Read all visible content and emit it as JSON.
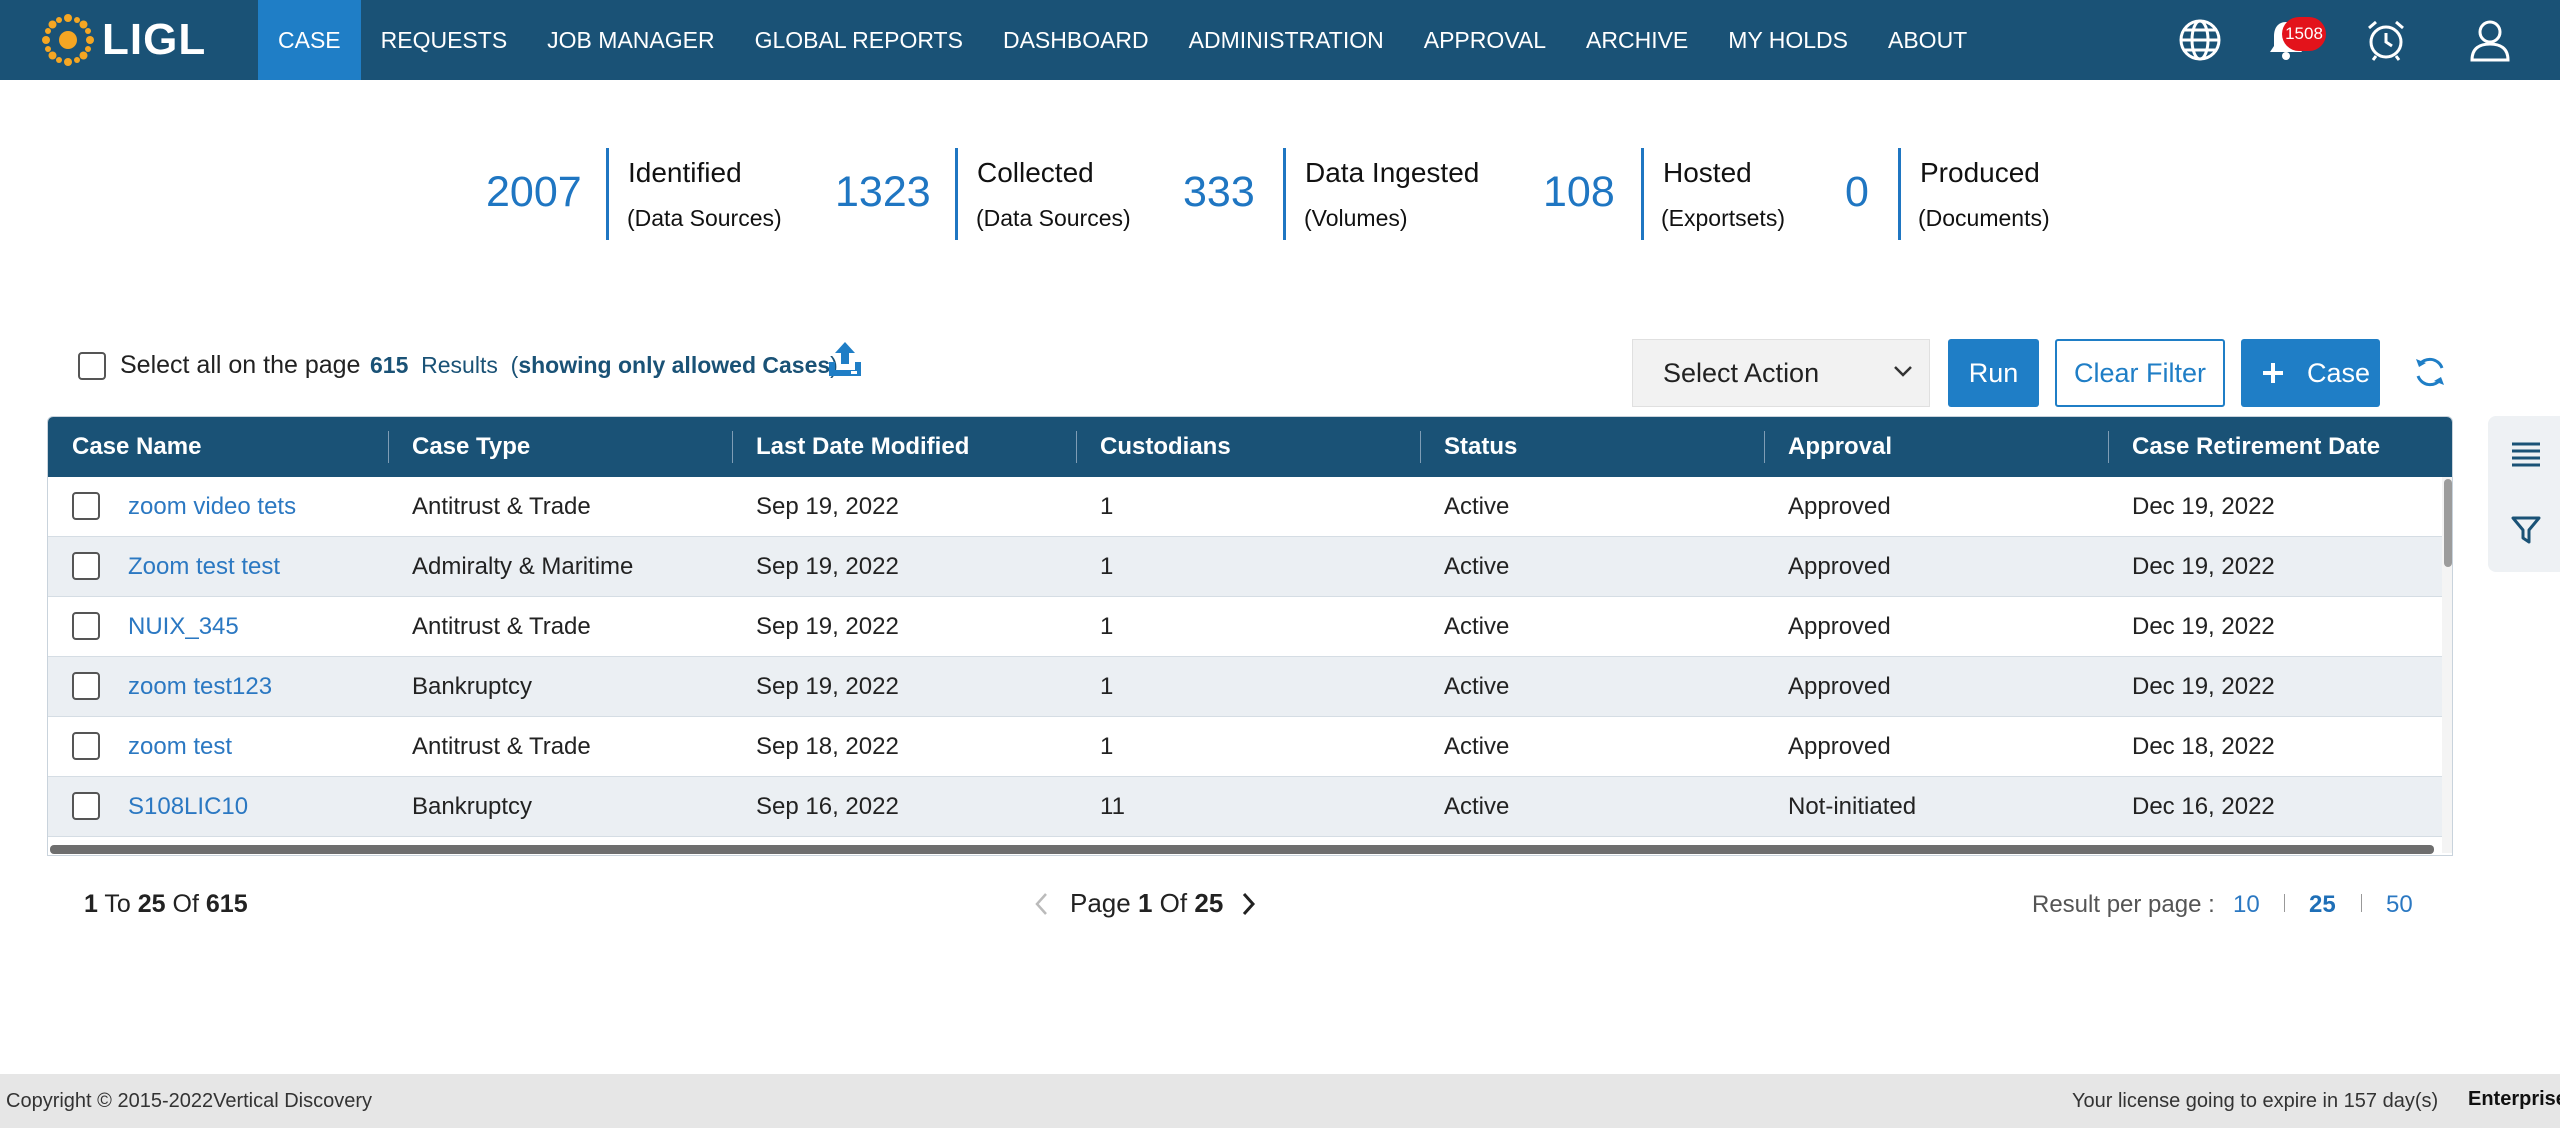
{
  "brand": {
    "logo_text": "LIGL"
  },
  "nav": {
    "items": [
      {
        "label": "CASE",
        "active": true
      },
      {
        "label": "REQUESTS"
      },
      {
        "label": "JOB MANAGER"
      },
      {
        "label": "GLOBAL REPORTS"
      },
      {
        "label": "DASHBOARD"
      },
      {
        "label": "ADMINISTRATION"
      },
      {
        "label": "APPROVAL"
      },
      {
        "label": "ARCHIVE"
      },
      {
        "label": "MY HOLDS"
      },
      {
        "label": "ABOUT"
      }
    ],
    "icons": [
      "globe-icon",
      "bell-icon",
      "alarm-clock-icon",
      "user-icon"
    ],
    "notification_count": "1508"
  },
  "stats": [
    {
      "value": "2007",
      "label": "Identified",
      "sub": "(Data Sources)"
    },
    {
      "value": "1323",
      "label": "Collected",
      "sub": "(Data Sources)"
    },
    {
      "value": "333",
      "label": "Data Ingested",
      "sub": "(Volumes)"
    },
    {
      "value": "108",
      "label": "Hosted",
      "sub": "(Exportsets)"
    },
    {
      "value": "0",
      "label": "Produced",
      "sub": "(Documents)"
    }
  ],
  "toolbar": {
    "select_all_label": "Select all on the page",
    "results_count": "615",
    "results_word": "Results",
    "results_note_open": "(",
    "results_note": "showing only allowed Cases",
    "results_note_close": ")",
    "select_action": "Select Action",
    "run_label": "Run",
    "clear_filter_label": "Clear Filter",
    "add_case_label": "Case",
    "colors": {
      "primary": "#1f7ec6",
      "header": "#1a5276"
    }
  },
  "table": {
    "columns": [
      "Case Name",
      "Case Type",
      "Last Date Modified",
      "Custodians",
      "Status",
      "Approval",
      "Case Retirement Date"
    ],
    "rows": [
      [
        "zoom video tets",
        "Antitrust & Trade",
        "Sep 19, 2022",
        "1",
        "Active",
        "Approved",
        "Dec 19, 2022"
      ],
      [
        "Zoom test test",
        "Admiralty & Maritime",
        "Sep 19, 2022",
        "1",
        "Active",
        "Approved",
        "Dec 19, 2022"
      ],
      [
        "NUIX_345",
        "Antitrust & Trade",
        "Sep 19, 2022",
        "1",
        "Active",
        "Approved",
        "Dec 19, 2022"
      ],
      [
        "zoom test123",
        "Bankruptcy",
        "Sep 19, 2022",
        "1",
        "Active",
        "Approved",
        "Dec 19, 2022"
      ],
      [
        "zoom test",
        "Antitrust & Trade",
        "Sep 18, 2022",
        "1",
        "Active",
        "Approved",
        "Dec 18, 2022"
      ],
      [
        "S108LIC10",
        "Bankruptcy",
        "Sep 16, 2022",
        "11",
        "Active",
        "Not-initiated",
        "Dec 16, 2022"
      ]
    ]
  },
  "pagination": {
    "from": "1",
    "to_word": "To",
    "to": "25",
    "of_word": "Of",
    "total": "615",
    "page_word": "Page",
    "page": "1",
    "page_of_word": "Of",
    "page_total": "25",
    "rpp_label": "Result per page :",
    "rpp_options": [
      "10",
      "25",
      "50"
    ],
    "rpp_selected": "25"
  },
  "footer": {
    "copyright": "Copyright © 2015-2022Vertical Discovery",
    "license": "Your license going to expire in 157 day(s)",
    "edition": "Enterprise"
  }
}
